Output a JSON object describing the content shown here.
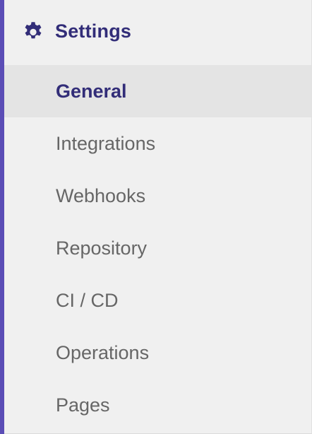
{
  "sidebar": {
    "header": {
      "icon": "gear-icon",
      "label": "Settings"
    },
    "items": [
      {
        "label": "General",
        "active": true
      },
      {
        "label": "Integrations",
        "active": false
      },
      {
        "label": "Webhooks",
        "active": false
      },
      {
        "label": "Repository",
        "active": false
      },
      {
        "label": "CI / CD",
        "active": false
      },
      {
        "label": "Operations",
        "active": false
      },
      {
        "label": "Pages",
        "active": false
      }
    ]
  },
  "colors": {
    "accent": "#5b4db6",
    "active_text": "#322d78",
    "item_text": "#666666",
    "background": "#f0f0f0",
    "active_background": "#e4e4e4"
  }
}
